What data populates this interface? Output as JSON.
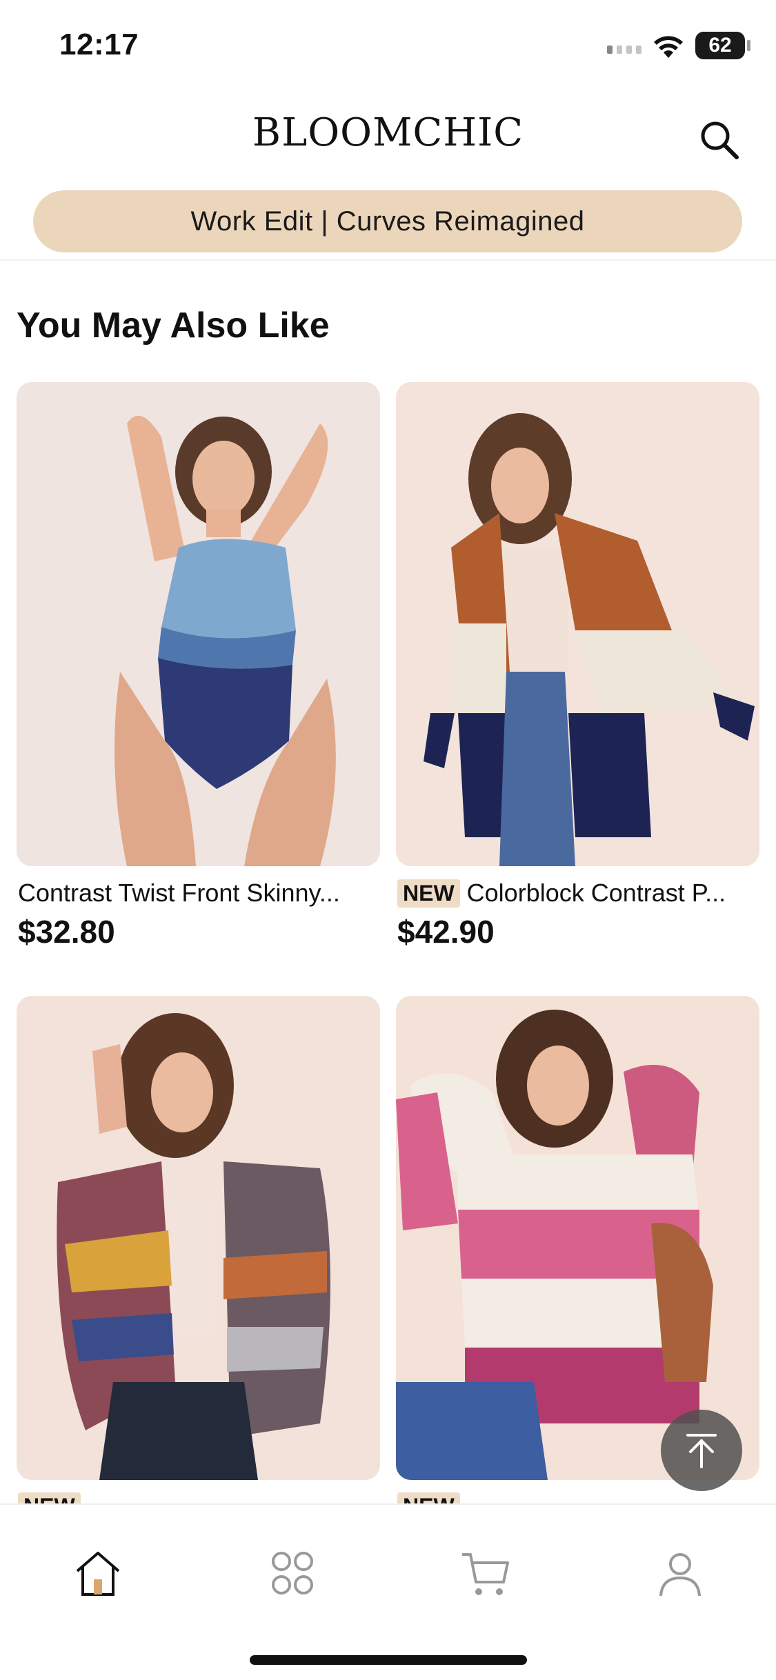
{
  "status_bar": {
    "time": "12:17",
    "battery": "62"
  },
  "header": {
    "logo": "BLOOMCHIC",
    "search_icon": "search-icon"
  },
  "promo": {
    "text": "Work Edit | Curves Reimagined"
  },
  "section": {
    "title": "You May Also Like"
  },
  "products": [
    {
      "new": "",
      "name": "Contrast Twist Front Skinny...",
      "price": "$32.80"
    },
    {
      "new": "NEW",
      "name": "Colorblock Contrast P...",
      "price": "$42.90"
    },
    {
      "new": "NEW",
      "name": "",
      "price": ""
    },
    {
      "new": "NEW",
      "name": "",
      "price": ""
    }
  ],
  "tab_bar": {
    "items": [
      {
        "icon": "home-icon"
      },
      {
        "icon": "categories-icon"
      },
      {
        "icon": "cart-icon"
      },
      {
        "icon": "profile-icon"
      }
    ]
  },
  "colors": {
    "promo_bg": "#ecd6bb",
    "badge_bg": "#efdcc6",
    "accent": "#111111"
  }
}
